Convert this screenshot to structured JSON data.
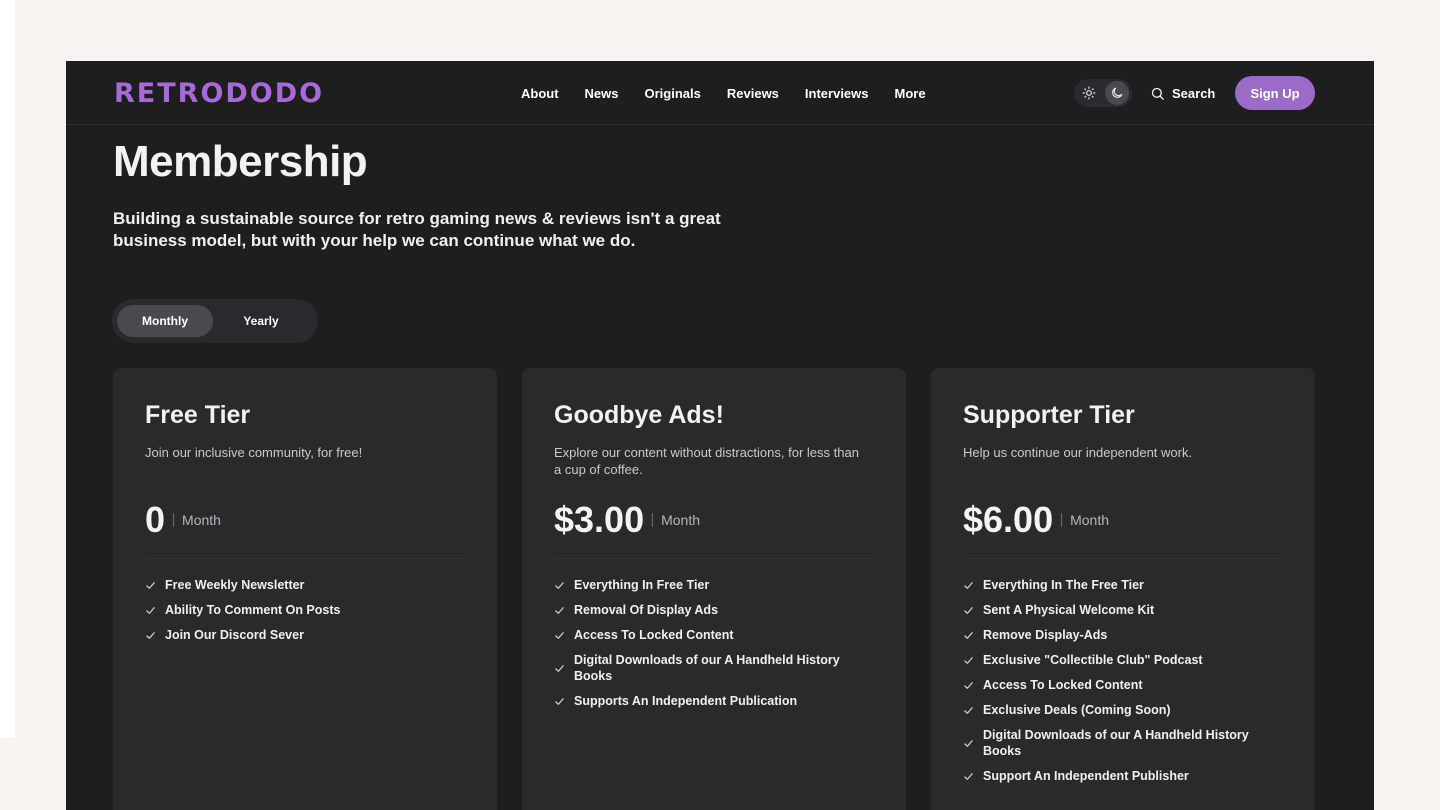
{
  "brand": {
    "logo_text": "RETRODODO",
    "accent": "#9c6bc8"
  },
  "nav": {
    "items": [
      "About",
      "News",
      "Originals",
      "Reviews",
      "Interviews",
      "More"
    ],
    "search_label": "Search",
    "signup_label": "Sign Up"
  },
  "hero": {
    "title": "Membership",
    "subtitle": "Building a sustainable source for retro gaming news & reviews isn't a great business model, but with your help we can continue what we do."
  },
  "billing": {
    "options": [
      "Monthly",
      "Yearly"
    ],
    "selected": "Monthly"
  },
  "tiers": [
    {
      "title": "Free Tier",
      "description": "Join our inclusive community, for free!",
      "price": "0",
      "period": "Month",
      "features": [
        "Free Weekly Newsletter",
        "Ability To Comment On Posts",
        "Join Our Discord Sever"
      ]
    },
    {
      "title": "Goodbye Ads!",
      "description": "Explore our content without distractions, for less than a cup of coffee.",
      "price": "$3.00",
      "period": "Month",
      "features": [
        "Everything In Free Tier",
        "Removal Of Display Ads",
        "Access To Locked Content",
        "Digital Downloads of our A Handheld History Books",
        "Supports An Independent Publication"
      ]
    },
    {
      "title": "Supporter Tier",
      "description": "Help us continue our independent work.",
      "price": "$6.00",
      "period": "Month",
      "features": [
        "Everything In The Free Tier",
        "Sent A Physical Welcome Kit",
        "Remove Display-Ads",
        "Exclusive \"Collectible Club\" Podcast",
        "Access To Locked Content",
        "Exclusive Deals (Coming Soon)",
        "Digital Downloads of our A Handheld History Books",
        "Support An Independent Publisher"
      ]
    }
  ]
}
